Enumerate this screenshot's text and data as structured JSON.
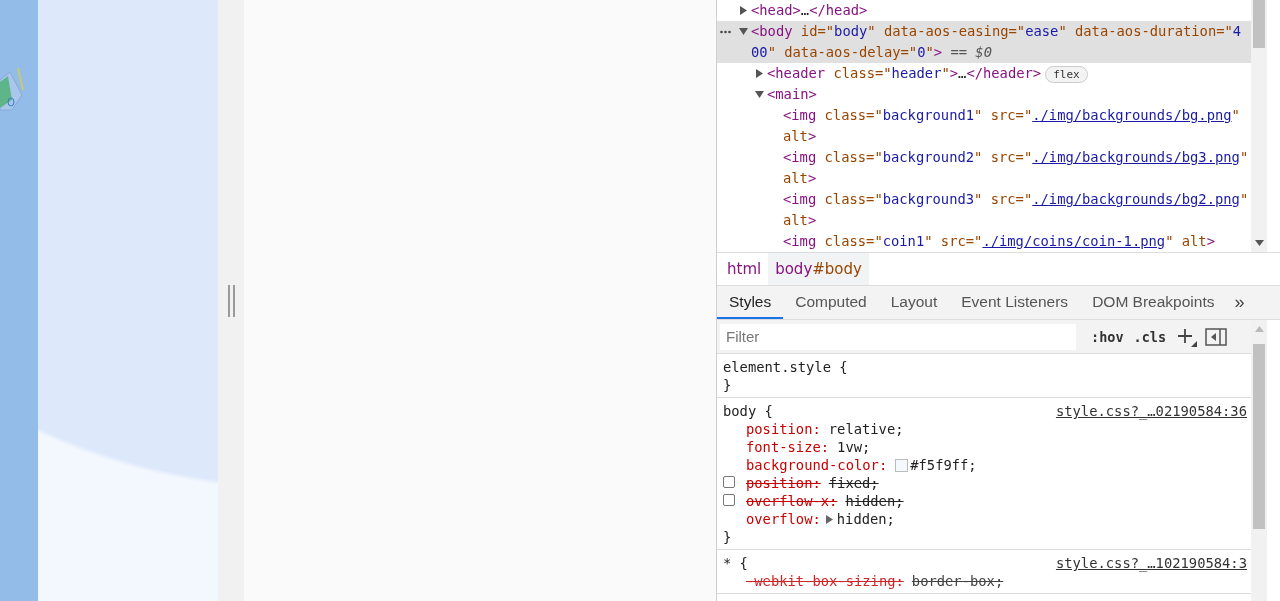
{
  "elements": {
    "tree": [
      {
        "kind": "container",
        "expanded": false,
        "selected": false,
        "tokens": [
          {
            "kind": "tag",
            "t": "<head>"
          },
          {
            "kind": "text",
            "t": "…"
          },
          {
            "kind": "tag",
            "t": "</head>"
          }
        ]
      },
      {
        "kind": "container",
        "expanded": true,
        "selected": true,
        "tokens": [
          {
            "kind": "tag",
            "t": "<body"
          },
          {
            "kind": "attr",
            "t": " id=\""
          },
          {
            "kind": "value",
            "t": "body"
          },
          {
            "kind": "attr",
            "t": "\" data-aos-easing=\""
          },
          {
            "kind": "value",
            "t": "ease"
          },
          {
            "kind": "attr",
            "t": "\" data-aos-duration=\""
          },
          {
            "kind": "value",
            "t": "400"
          },
          {
            "kind": "attr",
            "t": "\" data-aos-delay=\""
          },
          {
            "kind": "value",
            "t": "0"
          },
          {
            "kind": "attr",
            "t": "\""
          },
          {
            "kind": "tag",
            "t": ">"
          },
          {
            "kind": "hint",
            "t": " == $0"
          }
        ],
        "children": [
          {
            "kind": "container",
            "expanded": false,
            "selected": false,
            "badge": "flex",
            "tokens": [
              {
                "kind": "tag",
                "t": "<header"
              },
              {
                "kind": "attr",
                "t": " class=\""
              },
              {
                "kind": "value",
                "t": "header"
              },
              {
                "kind": "attr",
                "t": "\""
              },
              {
                "kind": "tag",
                "t": ">"
              },
              {
                "kind": "text",
                "t": "…"
              },
              {
                "kind": "tag",
                "t": "</header>"
              }
            ]
          },
          {
            "kind": "container",
            "expanded": true,
            "selected": false,
            "tokens": [
              {
                "kind": "tag",
                "t": "<main>"
              }
            ],
            "children": [
              {
                "kind": "leaf",
                "selected": false,
                "tokens": [
                  {
                    "kind": "tag",
                    "t": "<img"
                  },
                  {
                    "kind": "attr",
                    "t": " class=\""
                  },
                  {
                    "kind": "value",
                    "t": "background1"
                  },
                  {
                    "kind": "attr",
                    "t": "\" src=\""
                  },
                  {
                    "kind": "link",
                    "t": "./img/backgrounds/bg.png"
                  },
                  {
                    "kind": "attr",
                    "t": "\" alt"
                  },
                  {
                    "kind": "tag",
                    "t": ">"
                  }
                ]
              },
              {
                "kind": "leaf",
                "selected": false,
                "tokens": [
                  {
                    "kind": "tag",
                    "t": "<img"
                  },
                  {
                    "kind": "attr",
                    "t": " class=\""
                  },
                  {
                    "kind": "value",
                    "t": "background2"
                  },
                  {
                    "kind": "attr",
                    "t": "\" src=\""
                  },
                  {
                    "kind": "link",
                    "t": "./img/backgrounds/bg3.png"
                  },
                  {
                    "kind": "attr",
                    "t": "\" alt"
                  },
                  {
                    "kind": "tag",
                    "t": ">"
                  }
                ]
              },
              {
                "kind": "leaf",
                "selected": false,
                "tokens": [
                  {
                    "kind": "tag",
                    "t": "<img"
                  },
                  {
                    "kind": "attr",
                    "t": " class=\""
                  },
                  {
                    "kind": "value",
                    "t": "background3"
                  },
                  {
                    "kind": "attr",
                    "t": "\" src=\""
                  },
                  {
                    "kind": "link",
                    "t": "./img/backgrounds/bg2.png"
                  },
                  {
                    "kind": "attr",
                    "t": "\" alt"
                  },
                  {
                    "kind": "tag",
                    "t": ">"
                  }
                ]
              },
              {
                "kind": "leaf",
                "selected": false,
                "tokens": [
                  {
                    "kind": "tag",
                    "t": "<img"
                  },
                  {
                    "kind": "attr",
                    "t": " class=\""
                  },
                  {
                    "kind": "value",
                    "t": "coin1"
                  },
                  {
                    "kind": "attr",
                    "t": "\" src=\""
                  },
                  {
                    "kind": "link",
                    "t": "./img/coins/coin-1.png"
                  },
                  {
                    "kind": "attr",
                    "t": "\" alt"
                  },
                  {
                    "kind": "tag",
                    "t": ">"
                  }
                ]
              }
            ]
          }
        ]
      }
    ],
    "breadcrumbs": [
      {
        "tag": "html",
        "selected": false
      },
      {
        "tag": "body",
        "id": "#body",
        "selected": true
      }
    ]
  },
  "tabs": [
    {
      "label": "Styles",
      "selected": true
    },
    {
      "label": "Computed",
      "selected": false
    },
    {
      "label": "Layout",
      "selected": false
    },
    {
      "label": "Event Listeners",
      "selected": false
    },
    {
      "label": "DOM Breakpoints",
      "selected": false
    }
  ],
  "more_tabs": "»",
  "filter": {
    "placeholder": "Filter",
    "buttons": [
      ":hov",
      ".cls"
    ]
  },
  "rules": [
    {
      "selector": "element.style {",
      "close": "}"
    },
    {
      "selector": "body {",
      "source": "style.css?_…02190584:36",
      "close": "}",
      "declarations": [
        {
          "property": "position:",
          "value": "relative;",
          "kind": "plain",
          "disabled": false,
          "overridden": false
        },
        {
          "property": "font-size:",
          "value": "1vw;",
          "kind": "plain",
          "disabled": false,
          "overridden": false
        },
        {
          "property": "background-color:",
          "value": "#f5f9ff;",
          "kind": "color",
          "disabled": false,
          "overridden": false
        },
        {
          "property": "position:",
          "value": "fixed;",
          "kind": "plain",
          "disabled": true,
          "overridden": false
        },
        {
          "property": "overflow-x:",
          "value": "hidden;",
          "kind": "plain",
          "disabled": true,
          "overridden": false
        },
        {
          "property": "overflow:",
          "value": "hidden;",
          "kind": "shorthand",
          "disabled": false,
          "overridden": false
        }
      ]
    },
    {
      "selector": "* {",
      "source": "style.css?_…102190584:3",
      "declarations": [
        {
          "property": "-webkit-box-sizing:",
          "value": "border-box;",
          "kind": "plain",
          "disabled": false,
          "overridden": true
        }
      ]
    }
  ]
}
